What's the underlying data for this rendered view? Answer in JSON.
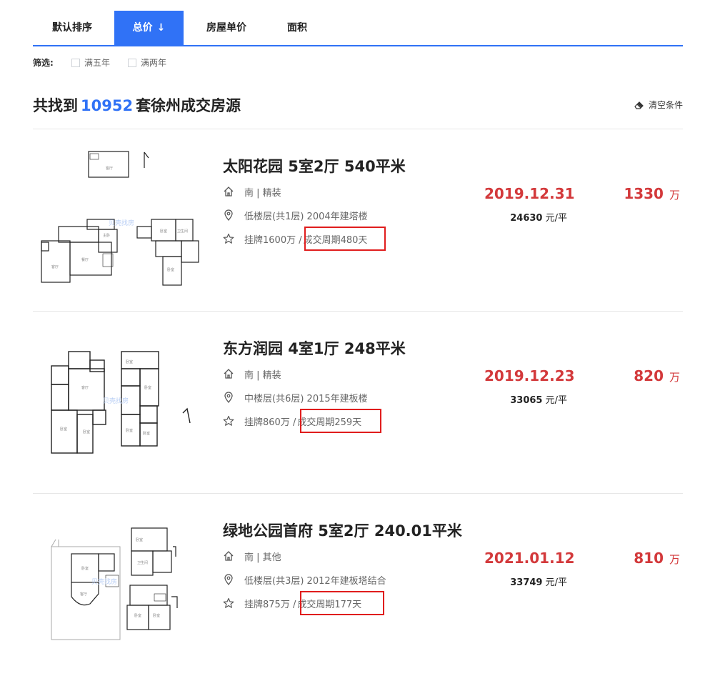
{
  "tabs": [
    {
      "label": "默认排序"
    },
    {
      "label": "总价",
      "arrow": "↓"
    },
    {
      "label": "房屋单价"
    },
    {
      "label": "面积"
    }
  ],
  "filter": {
    "label": "筛选:",
    "options": [
      "满五年",
      "满两年"
    ]
  },
  "heading": {
    "prefix": "共找到",
    "count": "10952",
    "suffix": "套徐州成交房源",
    "clear_label": "清空条件"
  },
  "listings": [
    {
      "title": "太阳花园 5室2厅 540平米",
      "orientation": "南 | 精装",
      "floor": "低楼层(共1层) 2004年建塔楼",
      "listed": "挂牌1600万 /",
      "cycle": "成交周期480天",
      "date": "2019.12.31",
      "unit_price_value": "24630",
      "unit_price_unit": "元/平",
      "total_value": "1330",
      "total_unit": "万"
    },
    {
      "title": "东方润园 4室1厅 248平米",
      "orientation": "南 | 精装",
      "floor": "中楼层(共6层) 2015年建板楼",
      "listed": "挂牌860万 /",
      "cycle": "成交周期259天",
      "date": "2019.12.23",
      "unit_price_value": "33065",
      "unit_price_unit": "元/平",
      "total_value": "820",
      "total_unit": "万"
    },
    {
      "title": "绿地公园首府 5室2厅 240.01平米",
      "orientation": "南 | 其他",
      "floor": "低楼层(共3层) 2012年建板塔结合",
      "listed": "挂牌875万 /",
      "cycle": "成交周期177天",
      "date": "2021.01.12",
      "unit_price_value": "33749",
      "unit_price_unit": "元/平",
      "total_value": "810",
      "total_unit": "万"
    }
  ],
  "colors": {
    "accent_blue": "#3072f6",
    "price_red": "#d3393b",
    "highlight_red": "#e01d1d"
  },
  "icons": [
    "house-icon",
    "location-pin-icon",
    "star-icon",
    "eraser-icon",
    "arrow-down-icon"
  ]
}
